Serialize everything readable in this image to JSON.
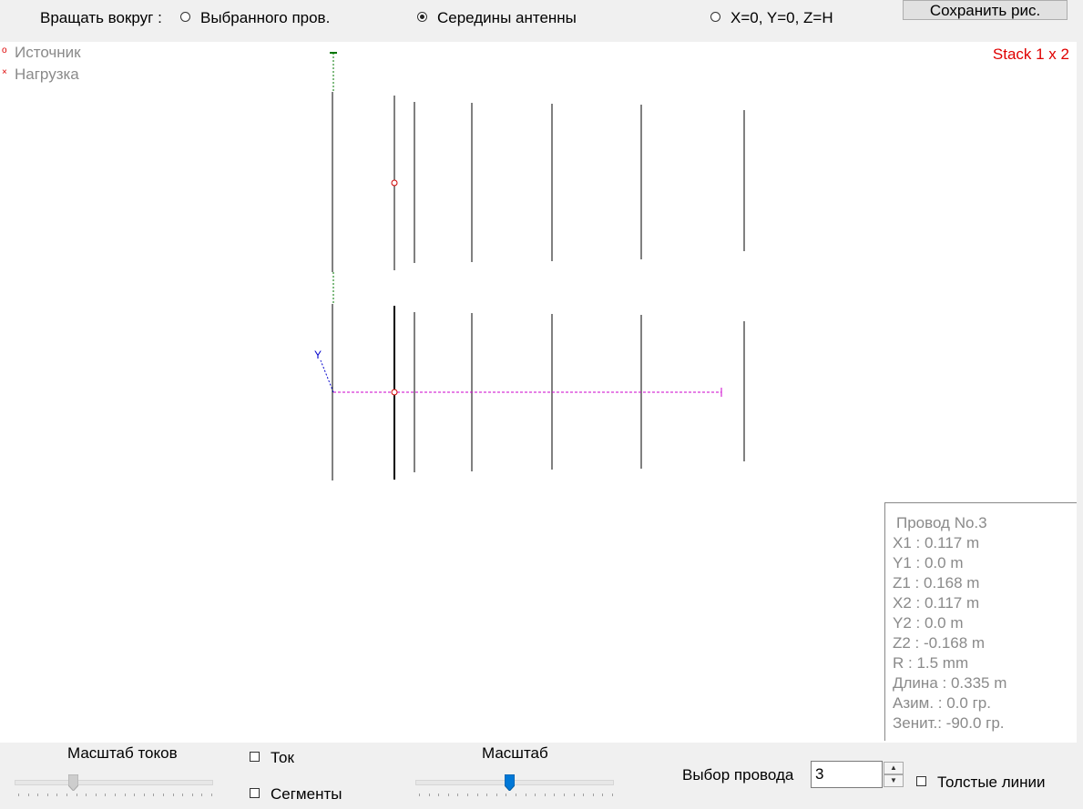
{
  "toolbar": {
    "rotate_label": "Вращать вокруг :",
    "options": [
      "Выбранного пров.",
      "Середины антенны",
      "X=0, Y=0, Z=H"
    ],
    "selected_option": "Середины антенны",
    "save_label": "Сохранить рис."
  },
  "legend": {
    "source_label": "Источник",
    "load_label": "Нагрузка",
    "source_symbol": "o",
    "load_symbol": "×"
  },
  "stack_label": "Stack 1 x 2",
  "axis": {
    "y_label": "Y"
  },
  "wire_info": {
    "title": "Провод No.3",
    "rows": [
      "X1   :  0.117 m",
      "Y1   :  0.0 m",
      "Z1   :  0.168 m",
      "X2   :  0.117 m",
      "Y2   :  0.0 m",
      "Z2   :  -0.168 m",
      "R    :  1.5 mm",
      " Длина  :  0.335 m",
      " Азим.   :  0.0 гр.",
      " Зенит.:  -90.0 гр."
    ]
  },
  "bottom": {
    "current_scale_label": "Масштаб токов",
    "current_scale_value": 0.3,
    "current_checkbox_label": "Ток",
    "current_checked": false,
    "segments_checkbox_label": "Сегменты",
    "segments_checked": false,
    "scale_label": "Масштаб",
    "scale_value": 0.48,
    "wire_select_label": "Выбор провода",
    "wire_select_value": "3",
    "thick_lines_label": "Толстые линии",
    "thick_lines_checked": false
  },
  "colors": {
    "stack_label": "#e00000",
    "source_marker": "#d00000",
    "boom_line": "#cc00cc",
    "mast_line": "#007700",
    "y_axis": "#0000cc",
    "slider_thumb_active": "#0078d7"
  }
}
